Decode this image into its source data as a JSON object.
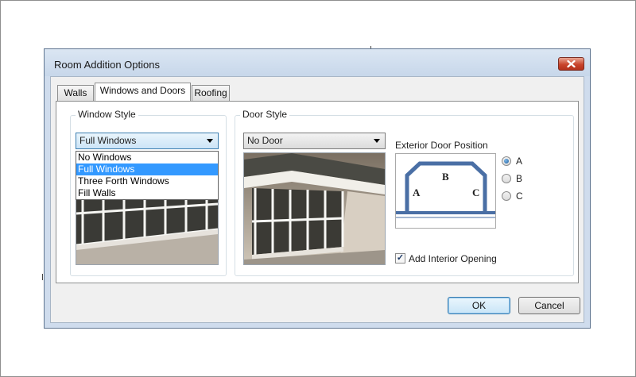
{
  "dialog": {
    "title": "Room Addition Options",
    "tabs": [
      {
        "label": "Walls"
      },
      {
        "label": "Windows and Doors"
      },
      {
        "label": "Roofing"
      }
    ],
    "active_tab": "Windows and Doors"
  },
  "window_style": {
    "group_label": "Window Style",
    "selected": "Full Windows",
    "options": [
      "No Windows",
      "Full Windows",
      "Three Forth Windows",
      "Fill Walls"
    ],
    "dropdown_open": true
  },
  "door_style": {
    "group_label": "Door Style",
    "selected": "No Door"
  },
  "exterior_door": {
    "label": "Exterior Door Position",
    "diagram_labels": {
      "a": "A",
      "b": "B",
      "c": "C"
    },
    "options": [
      "A",
      "B",
      "C"
    ],
    "selected": "A"
  },
  "interior_opening": {
    "label": "Add Interior Opening",
    "checked": true
  },
  "buttons": {
    "ok": "OK",
    "cancel": "Cancel"
  },
  "colors": {
    "accent": "#3399ff",
    "close_button": "#c9452c",
    "room_outline": "#4a6fa5"
  }
}
